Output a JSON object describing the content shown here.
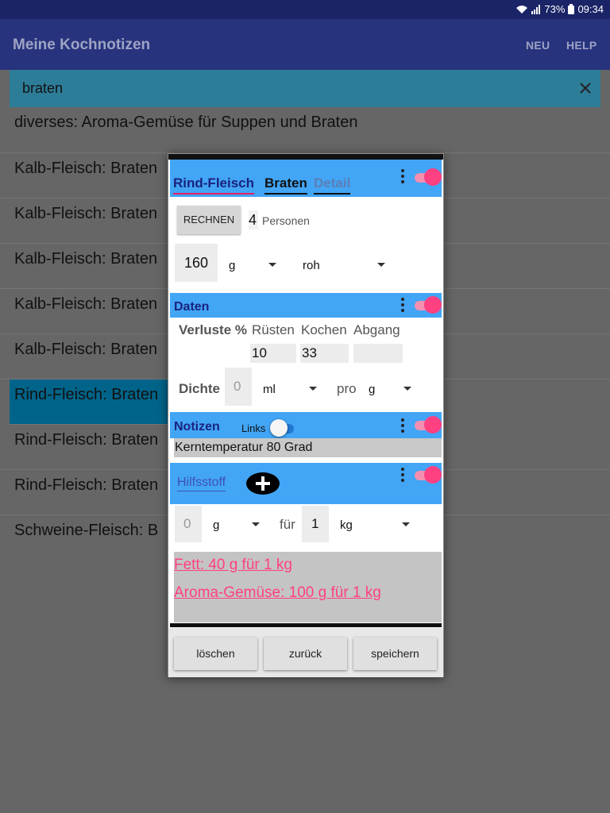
{
  "status": {
    "battery": "73%",
    "time": "09:34"
  },
  "appbar": {
    "title": "Meine Kochnotizen",
    "actions": [
      "NEU",
      "HELP"
    ]
  },
  "search": {
    "query": "braten"
  },
  "list": [
    "diverses: Aroma-Gemüse für Suppen und Braten",
    "Kalb-Fleisch: Braten",
    "Kalb-Fleisch: Braten",
    "Kalb-Fleisch: Braten",
    "Kalb-Fleisch: Braten",
    "Kalb-Fleisch: Braten",
    "Rind-Fleisch: Braten",
    "Rind-Fleisch: Braten",
    "Rind-Fleisch: Braten",
    "Schweine-Fleisch: B"
  ],
  "selected_index": 6,
  "dialog": {
    "tabs": [
      "Rind-Fleisch",
      "Braten",
      "Detail"
    ],
    "rechnen": {
      "button": "RECHNEN",
      "persons_value": "4",
      "persons_label": "Personen",
      "amount": "160",
      "unit": "g",
      "state": "roh"
    },
    "daten": {
      "title": "Daten",
      "verluste_label": "Verluste %",
      "cols": [
        "Rüsten",
        "Kochen",
        "Abgang"
      ],
      "values": [
        "10",
        "33",
        ""
      ],
      "dichte_label": "Dichte",
      "dichte_value": "0",
      "dichte_unit": "ml",
      "pro_label": "pro",
      "pro_unit": "g"
    },
    "notizen": {
      "title": "Notizen",
      "links_label": "Links",
      "text": "Kerntemperatur 80 Grad"
    },
    "hilfsstoff": {
      "title": "Hilfsstoff",
      "amount": "0",
      "unit": "g",
      "fuer_label": "für",
      "per_value": "1",
      "per_unit": "kg",
      "items": [
        "Fett: 40 g für 1 kg",
        "Aroma-Gemüse: 100 g für 1 kg"
      ]
    },
    "footer": [
      "löschen",
      "zurück",
      "speichern"
    ]
  },
  "colors": {
    "accent": "#ff4081",
    "section": "#42a5f5",
    "appbar": "#27337d",
    "link": "#ff4081"
  }
}
